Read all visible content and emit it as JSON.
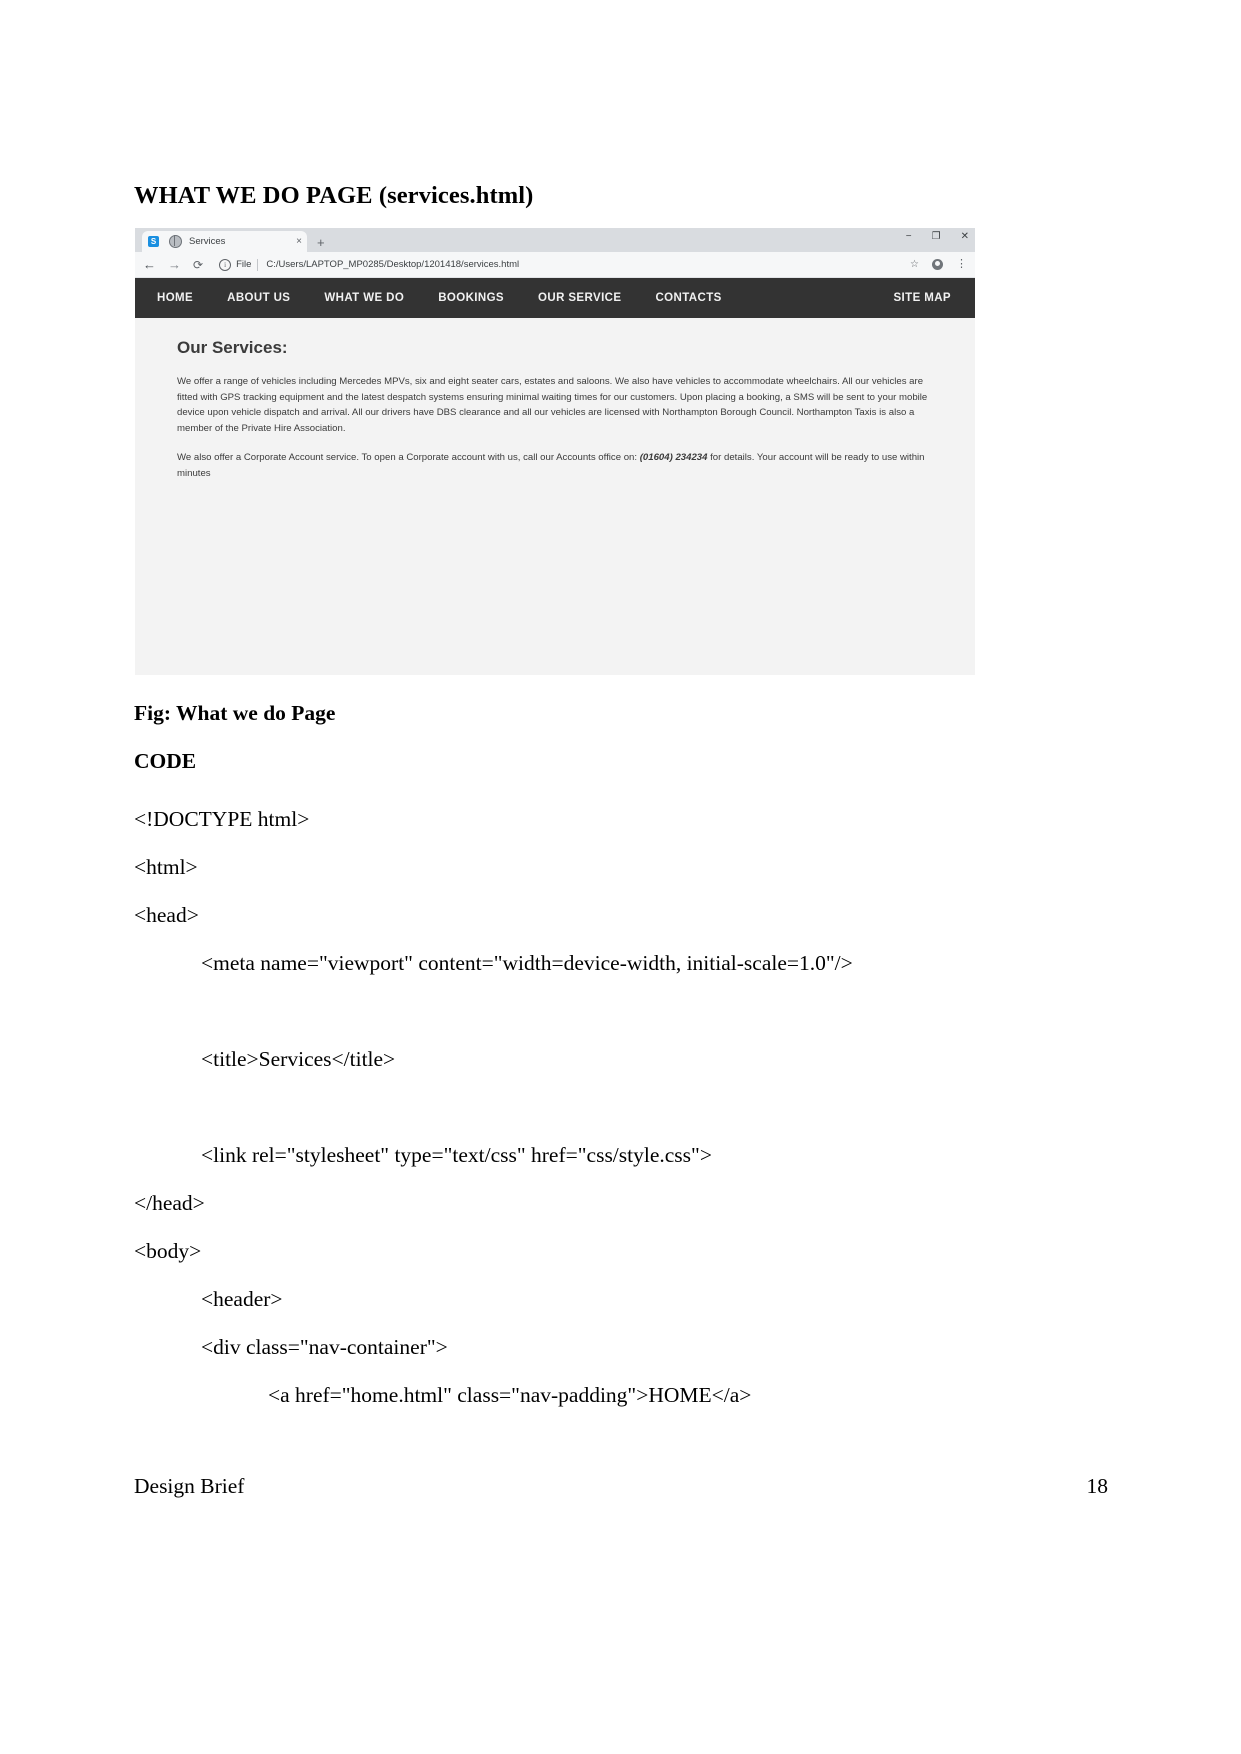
{
  "document": {
    "heading": "WHAT WE DO PAGE (services.html)",
    "figure_caption": "Fig: What we do Page",
    "code_label": "CODE",
    "footer_left": "Design Brief",
    "footer_page": "18"
  },
  "browser": {
    "tab": {
      "favicon_letter": "S",
      "title": "Services",
      "close_label": "×",
      "new_tab_label": "+"
    },
    "window_controls": {
      "minimize": "−",
      "maximize": "❐",
      "close": "✕"
    },
    "toolbar": {
      "back": "←",
      "forward": "→",
      "reload": "⟳",
      "info": "i",
      "file_label": "File",
      "url": "C:/Users/LAPTOP_MP0285/Desktop/1201418/services.html",
      "star": "☆",
      "menu": "⋮"
    }
  },
  "site": {
    "nav": {
      "items": [
        {
          "label": "HOME"
        },
        {
          "label": "ABOUT US"
        },
        {
          "label": "WHAT WE DO"
        },
        {
          "label": "BOOKINGS"
        },
        {
          "label": "OUR SERVICE"
        },
        {
          "label": "CONTACTS"
        }
      ],
      "right_item": "SITE MAP"
    },
    "content": {
      "heading": "Our Services:",
      "paragraph_1": "We offer a range of vehicles including Mercedes MPVs, six and eight seater cars, estates and saloons. We also have vehicles to accommodate wheelchairs. All our vehicles are fitted with GPS tracking equipment and the latest despatch systems ensuring minimal waiting times for our customers. Upon placing a booking, a SMS will be sent to your mobile device upon vehicle dispatch and arrival. All our drivers have DBS clearance and all our vehicles are licensed with Northampton Borough Council. Northampton Taxis is also a member of the Private Hire Association.",
      "paragraph_2_before": "We also offer a Corporate Account service. To open a Corporate account with us, call our Accounts office on: ",
      "paragraph_2_phone": "(01604) 234234",
      "paragraph_2_after": " for details. Your account will be ready to use within minutes"
    }
  },
  "code": {
    "lines": [
      {
        "text": "<!DOCTYPE html>",
        "indent": 0
      },
      {
        "text": "<html>",
        "indent": 0
      },
      {
        "text": "<head>",
        "indent": 0
      },
      {
        "text": "<meta name=\"viewport\" content=\"width=device-width, initial-scale=1.0\"/>",
        "indent": 1
      },
      {
        "text": "",
        "indent": 0
      },
      {
        "text": "<title>Services</title>",
        "indent": 1
      },
      {
        "text": "",
        "indent": 0
      },
      {
        "text": "<link rel=\"stylesheet\" type=\"text/css\" href=\"css/style.css\">",
        "indent": 1
      },
      {
        "text": "</head>",
        "indent": 0
      },
      {
        "text": "<body>",
        "indent": 0
      },
      {
        "text": "<header>",
        "indent": 1
      },
      {
        "text": "<div class=\"nav-container\">",
        "indent": 1
      },
      {
        "text": "<a href=\"home.html\" class=\"nav-padding\">HOME</a>",
        "indent": 2
      }
    ]
  }
}
